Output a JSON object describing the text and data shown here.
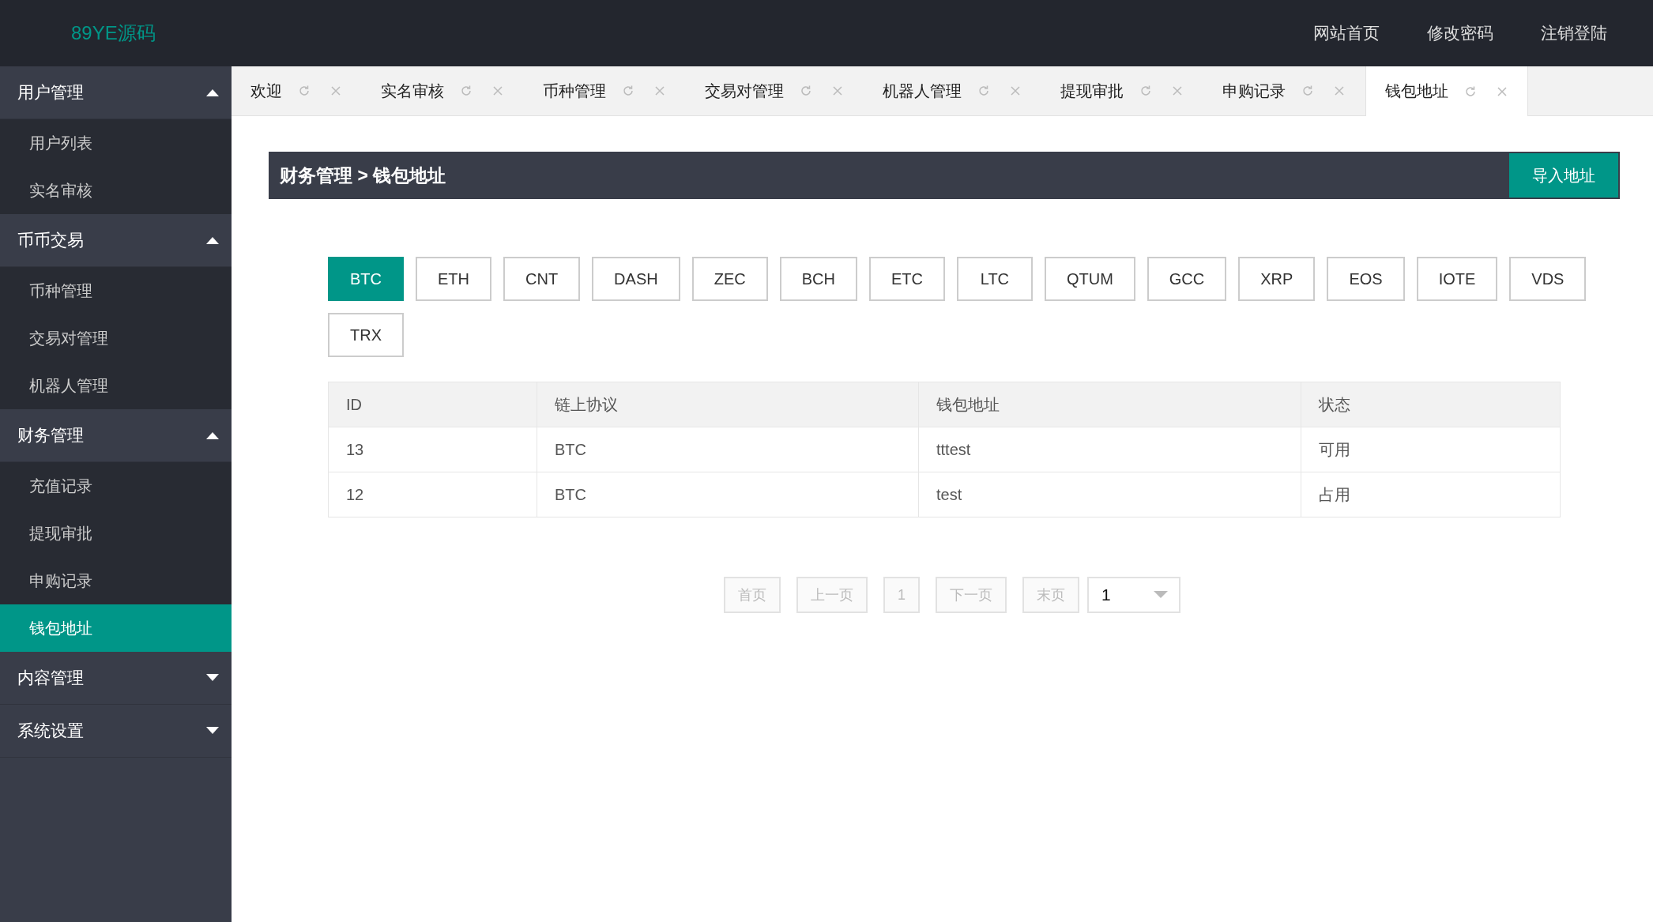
{
  "header": {
    "logo": "89YE源码",
    "nav": [
      "网站首页",
      "修改密码",
      "注销登陆"
    ]
  },
  "sidebar": {
    "groups": [
      {
        "label": "用户管理",
        "expanded": true,
        "children": [
          {
            "label": "用户列表",
            "selected": false
          },
          {
            "label": "实名审核",
            "selected": false
          }
        ]
      },
      {
        "label": "币币交易",
        "expanded": true,
        "children": [
          {
            "label": "币种管理",
            "selected": false
          },
          {
            "label": "交易对管理",
            "selected": false
          },
          {
            "label": "机器人管理",
            "selected": false
          }
        ]
      },
      {
        "label": "财务管理",
        "expanded": true,
        "children": [
          {
            "label": "充值记录",
            "selected": false
          },
          {
            "label": "提现审批",
            "selected": false
          },
          {
            "label": "申购记录",
            "selected": false
          },
          {
            "label": "钱包地址",
            "selected": true
          }
        ]
      },
      {
        "label": "内容管理",
        "expanded": false
      },
      {
        "label": "系统设置",
        "expanded": false
      }
    ]
  },
  "tabs": [
    {
      "label": "欢迎",
      "selected": false
    },
    {
      "label": "实名审核",
      "selected": false
    },
    {
      "label": "币种管理",
      "selected": false
    },
    {
      "label": "交易对管理",
      "selected": false
    },
    {
      "label": "机器人管理",
      "selected": false
    },
    {
      "label": "提现审批",
      "selected": false
    },
    {
      "label": "申购记录",
      "selected": false
    },
    {
      "label": "钱包地址",
      "selected": true
    }
  ],
  "title_bar": {
    "breadcrumb": "财务管理 > 钱包地址",
    "button": "导入地址"
  },
  "coins": [
    {
      "label": "BTC",
      "selected": true
    },
    {
      "label": "ETH",
      "selected": false
    },
    {
      "label": "CNT",
      "selected": false
    },
    {
      "label": "DASH",
      "selected": false
    },
    {
      "label": "ZEC",
      "selected": false
    },
    {
      "label": "BCH",
      "selected": false
    },
    {
      "label": "ETC",
      "selected": false
    },
    {
      "label": "LTC",
      "selected": false
    },
    {
      "label": "QTUM",
      "selected": false
    },
    {
      "label": "GCC",
      "selected": false
    },
    {
      "label": "XRP",
      "selected": false
    },
    {
      "label": "EOS",
      "selected": false
    },
    {
      "label": "IOTE",
      "selected": false
    },
    {
      "label": "VDS",
      "selected": false
    },
    {
      "label": "TRX",
      "selected": false
    }
  ],
  "table": {
    "columns": [
      "ID",
      "链上协议",
      "钱包地址",
      "状态"
    ],
    "rows": [
      [
        "13",
        "BTC",
        "tttest",
        "可用"
      ],
      [
        "12",
        "BTC",
        "test",
        "占用"
      ]
    ]
  },
  "pagination": {
    "buttons": [
      {
        "label": "首页",
        "disabled": true
      },
      {
        "label": "上一页",
        "disabled": true
      },
      {
        "label": "1",
        "disabled": true
      },
      {
        "label": "下一页",
        "disabled": true
      },
      {
        "label": "末页",
        "disabled": true
      }
    ],
    "page_select": "1"
  }
}
